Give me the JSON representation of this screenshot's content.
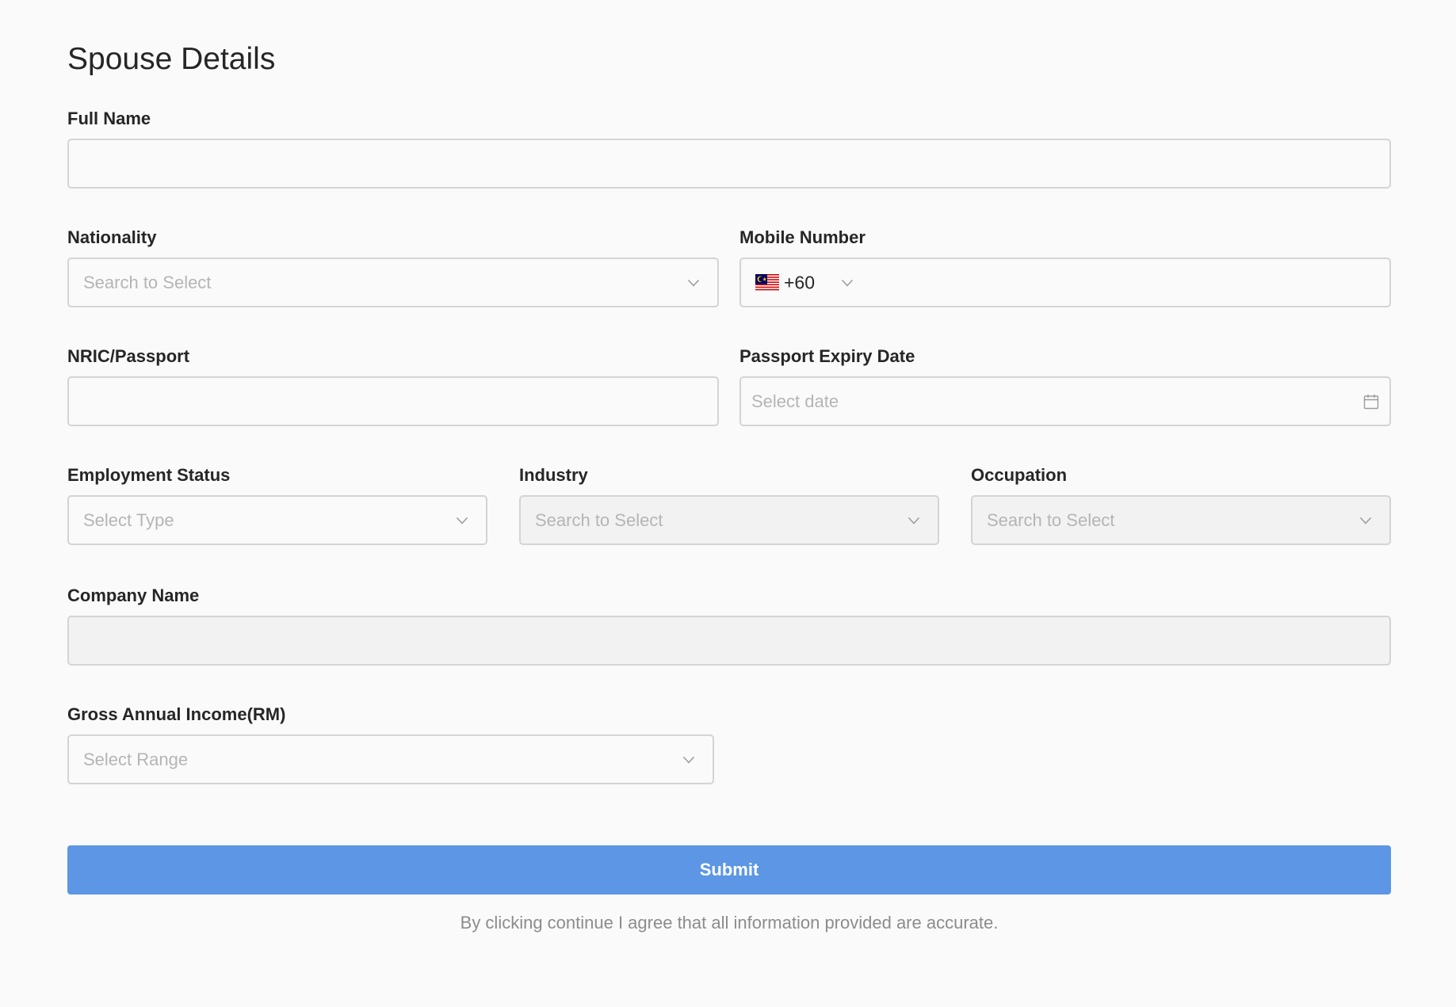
{
  "form": {
    "title": "Spouse Details",
    "full_name": {
      "label": "Full Name",
      "value": ""
    },
    "nationality": {
      "label": "Nationality",
      "placeholder": "Search to Select",
      "icon": "chevron-down-icon"
    },
    "mobile_number": {
      "label": "Mobile Number",
      "country_flag": "malaysia-flag-icon",
      "dial_code": "+60",
      "value": ""
    },
    "nric_passport": {
      "label": "NRIC/Passport",
      "value": ""
    },
    "passport_expiry_date": {
      "label": "Passport Expiry Date",
      "placeholder": "Select date",
      "icon": "calendar-icon"
    },
    "employment_status": {
      "label": "Employment Status",
      "placeholder": "Select Type"
    },
    "industry": {
      "label": "Industry",
      "placeholder": "Search to Select",
      "disabled": true
    },
    "occupation": {
      "label": "Occupation",
      "placeholder": "Search to Select",
      "disabled": true
    },
    "company_name": {
      "label": "Company Name",
      "value": "",
      "disabled": true
    },
    "gross_annual_income": {
      "label": "Gross Annual Income(RM)",
      "placeholder": "Select Range"
    },
    "submit_label": "Submit",
    "disclaimer": "By clicking continue I agree that all information provided are accurate."
  },
  "colors": {
    "background": "#fafafa",
    "border": "#d4d4d4",
    "disabled_background": "#f2f2f2",
    "placeholder": "#b5b5b5",
    "label": "#262626",
    "primary_button": "#5c96e4",
    "disclaimer_text": "#8c8c8c"
  }
}
